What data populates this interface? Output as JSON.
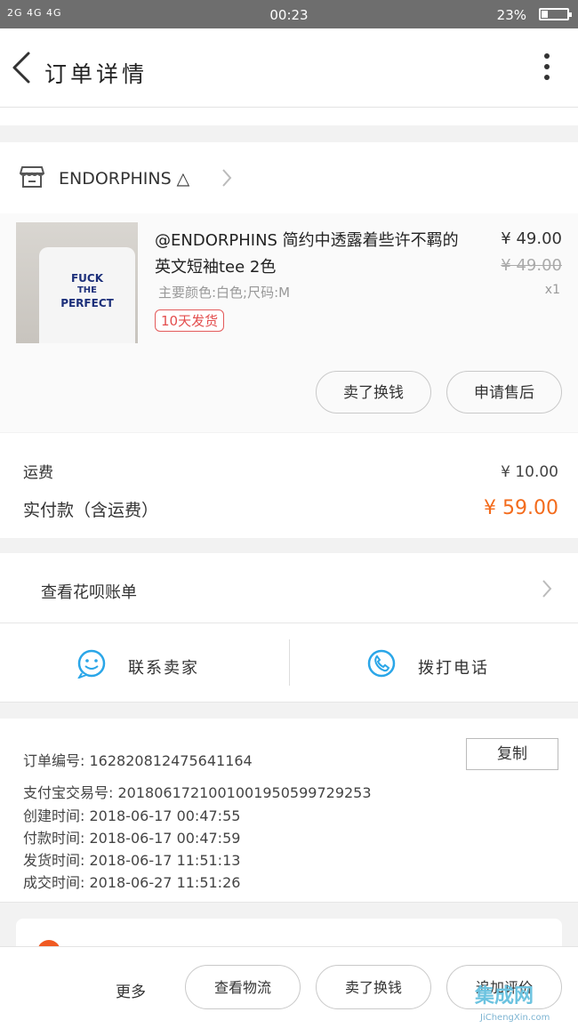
{
  "status_bar": {
    "signal": "2G 4G 4G",
    "time": "00:23",
    "battery": "23%",
    "battery_level": 0.23
  },
  "header": {
    "title": "订单详情"
  },
  "shop": {
    "name": "ENDORPHINS △"
  },
  "product": {
    "title": "@ENDORPHINS 简约中透露着些许不羁的英文短袖tee 2色",
    "spec": "主要颜色:白色;尺码:M",
    "tag": "10天发货",
    "price": "¥ 49.00",
    "original_price": "¥ 49.00",
    "quantity": "x1",
    "thumbnail_text": [
      "FUCK",
      "THE",
      "PERFECT"
    ],
    "buttons": {
      "sell": "卖了换钱",
      "after_sale": "申请售后"
    }
  },
  "fees": {
    "shipping_label": "运费",
    "shipping_value": "¥ 10.00",
    "paid_label": "实付款（含运费）",
    "paid_value": "¥ 59.00"
  },
  "huabei": {
    "label": "查看花呗账单"
  },
  "contact": {
    "seller": "联系卖家",
    "phone": "拨打电话"
  },
  "order_info": {
    "copy_label": "复制",
    "rows": [
      {
        "key": "订单编号:",
        "value": "162820812475641164"
      },
      {
        "key": "支付宝交易号:",
        "value": "2018061721001001950599729253"
      },
      {
        "key": "创建时间:",
        "value": "2018-06-17 00:47:55"
      },
      {
        "key": "付款时间:",
        "value": "2018-06-17 00:47:59"
      },
      {
        "key": "发货时间:",
        "value": "2018-06-17 11:51:13"
      },
      {
        "key": "成交时间:",
        "value": "2018-06-27 11:51:26"
      }
    ]
  },
  "bottom_bar": {
    "more": "更多",
    "logistics": "查看物流",
    "sell": "卖了换钱",
    "review": "追加评价"
  },
  "watermark": {
    "text": "集成网",
    "sub": "JiChengXin.com"
  },
  "colors": {
    "accent_orange": "#f36b1c",
    "tag_red": "#e34d4d",
    "icon_blue": "#2aa6e8"
  }
}
